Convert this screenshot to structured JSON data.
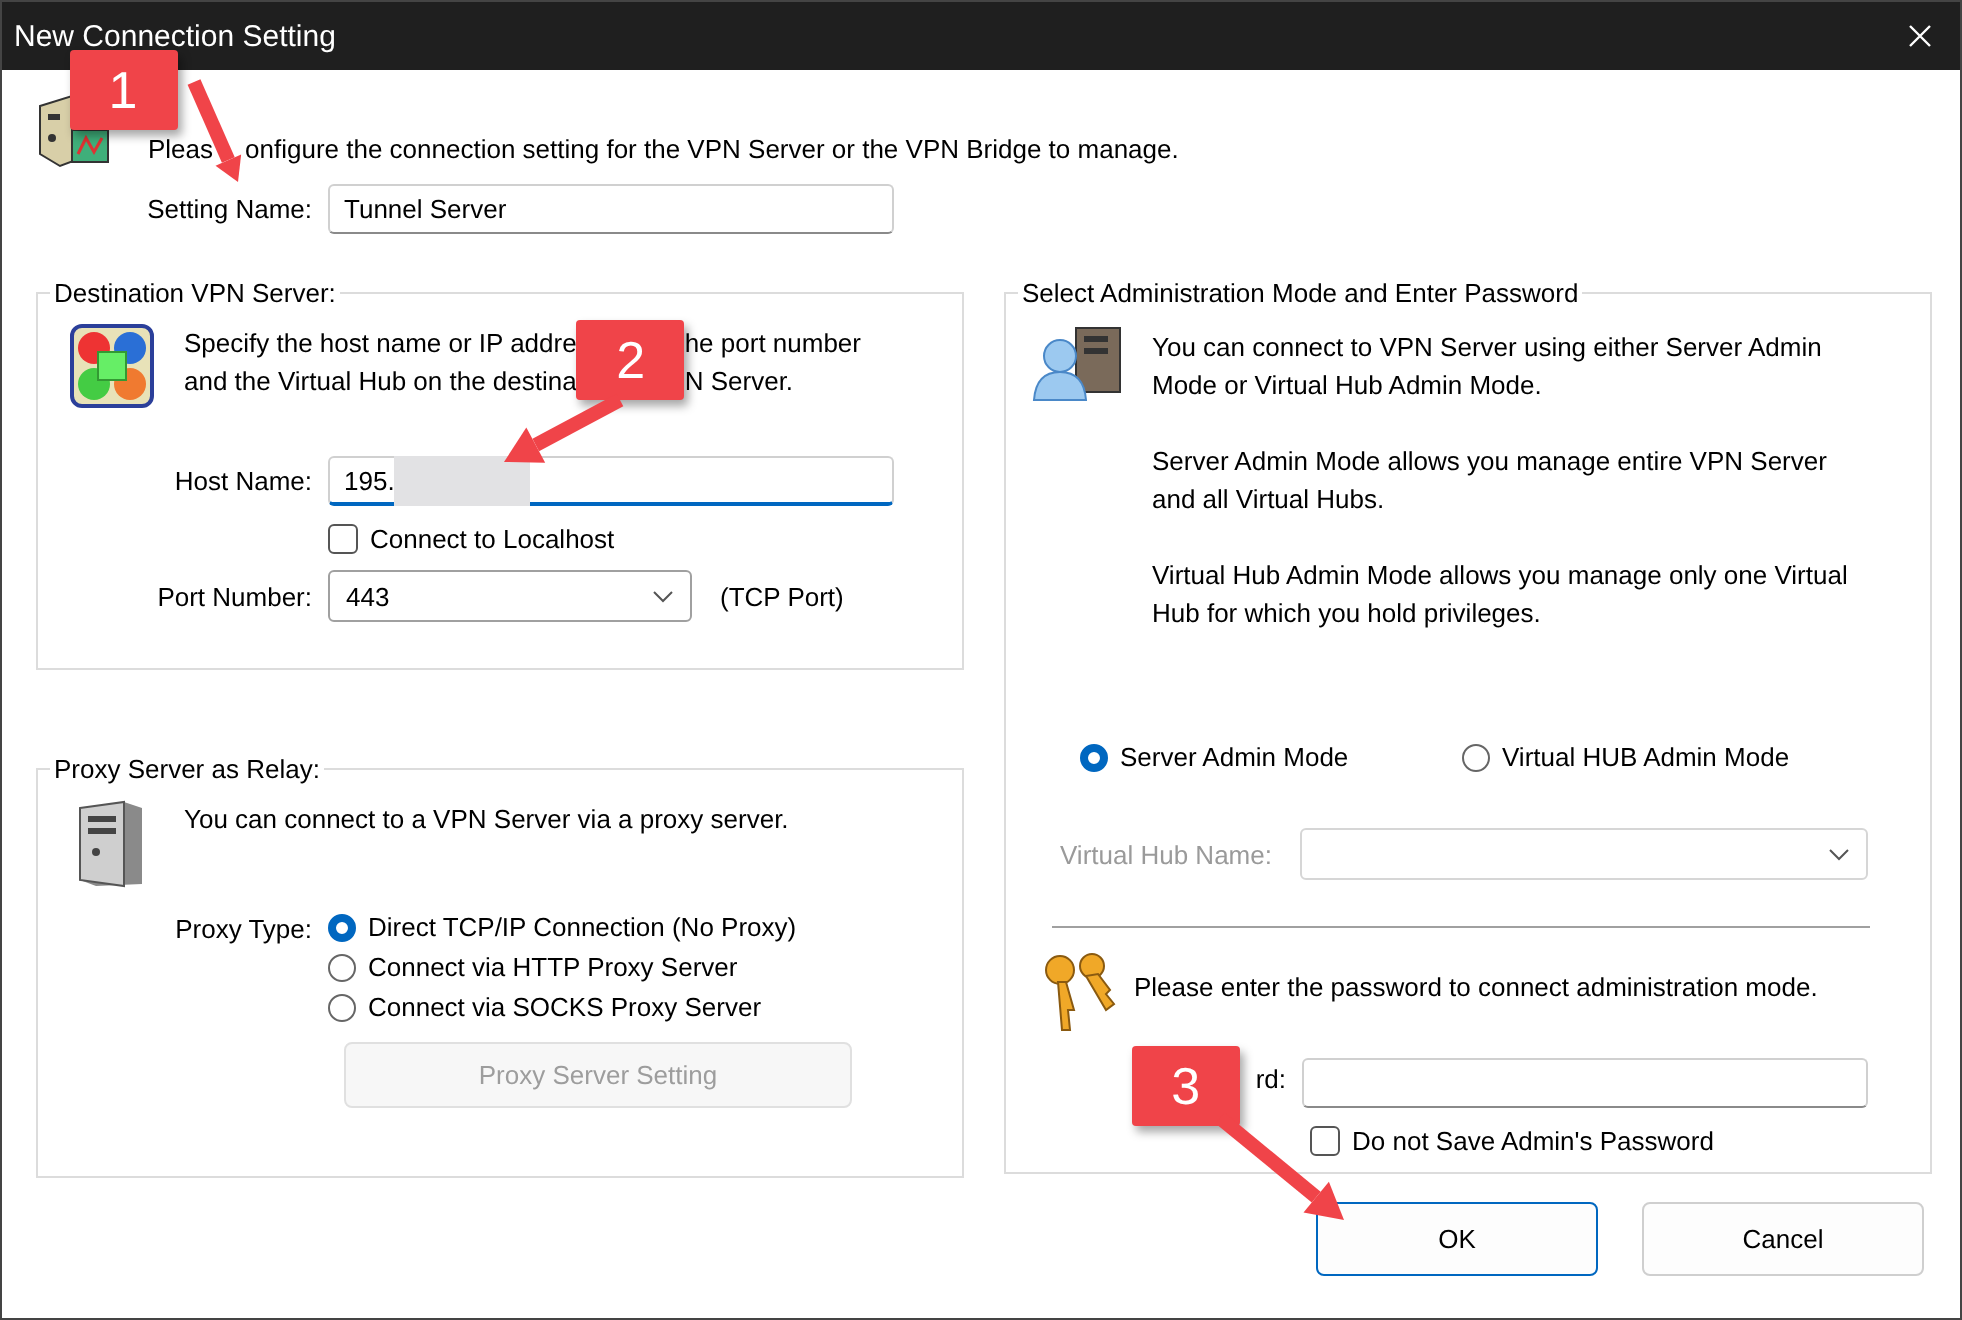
{
  "window": {
    "title": "New Connection Setting"
  },
  "intro": {
    "parts": [
      "Pleas",
      "onfigure the connection setting for the VPN Server or the VPN Bridge to manage."
    ]
  },
  "setting_name": {
    "label": "Setting Name:",
    "value": "Tunnel Server"
  },
  "destination": {
    "title": "Destination VPN Server:",
    "description_lines": [
      [
        "Specify the host name or IP addre",
        "he port number"
      ],
      [
        "and the Virtual Hub on the destina",
        "N Server."
      ]
    ],
    "host": {
      "label": "Host Name:",
      "value": "195."
    },
    "localhost": {
      "label": "Connect to Localhost",
      "checked": false
    },
    "port": {
      "label": "Port Number:",
      "value": "443",
      "unit": "(TCP Port)"
    }
  },
  "proxy": {
    "title": "Proxy Server as Relay:",
    "description": "You can connect to a VPN Server via a proxy server.",
    "type_label": "Proxy Type:",
    "options": [
      {
        "label": "Direct TCP/IP Connection (No Proxy)",
        "selected": true
      },
      {
        "label": "Connect via HTTP Proxy Server",
        "selected": false
      },
      {
        "label": "Connect via SOCKS Proxy Server",
        "selected": false
      }
    ],
    "setting_button": {
      "label": "Proxy Server Setting",
      "disabled": true
    }
  },
  "admin": {
    "title": "Select Administration Mode and Enter Password",
    "paragraphs": [
      "You can connect to VPN Server using either Server Admin Mode or Virtual Hub Admin Mode.",
      "Server Admin Mode allows you manage entire VPN Server and all Virtual Hubs.",
      "Virtual Hub Admin Mode allows you manage only one Virtual Hub for which you hold privileges."
    ],
    "modes": [
      {
        "label": "Server Admin Mode",
        "selected": true
      },
      {
        "label": "Virtual HUB Admin Mode",
        "selected": false
      }
    ],
    "hub": {
      "label": "Virtual Hub Name:",
      "disabled": true
    },
    "password_prompt": "Please enter the password to connect administration mode.",
    "password_label": "rd:",
    "no_save": {
      "label": "Do not Save Admin's Password",
      "checked": false
    }
  },
  "buttons": [
    {
      "label": "OK",
      "default": true
    },
    {
      "label": "Cancel",
      "default": false
    }
  ],
  "callouts": [
    {
      "number": "1"
    },
    {
      "number": "2"
    },
    {
      "number": "3"
    }
  ]
}
